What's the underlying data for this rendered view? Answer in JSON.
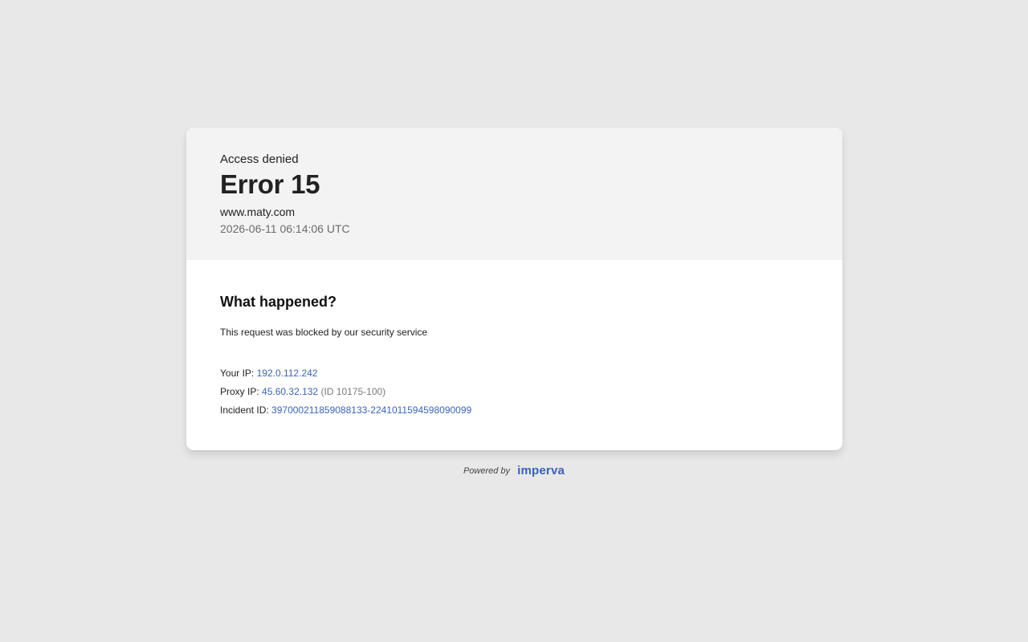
{
  "header": {
    "status_label": "Access denied",
    "error_title": "Error 15",
    "site": "www.maty.com",
    "timestamp": "2026-06-11 06:14:06 UTC"
  },
  "body": {
    "heading": "What happened?",
    "message": "This request was blocked by our security service",
    "your_ip_label": "Your IP:",
    "your_ip_value": "192.0.112.242",
    "proxy_ip_label": "Proxy IP:",
    "proxy_ip_value": "45.60.32.132",
    "proxy_id": "(ID 10175-100)",
    "incident_label": "Incident ID:",
    "incident_value": "397000211859088133-2241011594598090099"
  },
  "footer": {
    "powered_by": "Powered by",
    "brand": "imperva"
  },
  "colors": {
    "background": "#e8e8e8",
    "header_bg": "#f3f3f3",
    "link": "#3a63b8",
    "brand": "#3a5fc0"
  }
}
